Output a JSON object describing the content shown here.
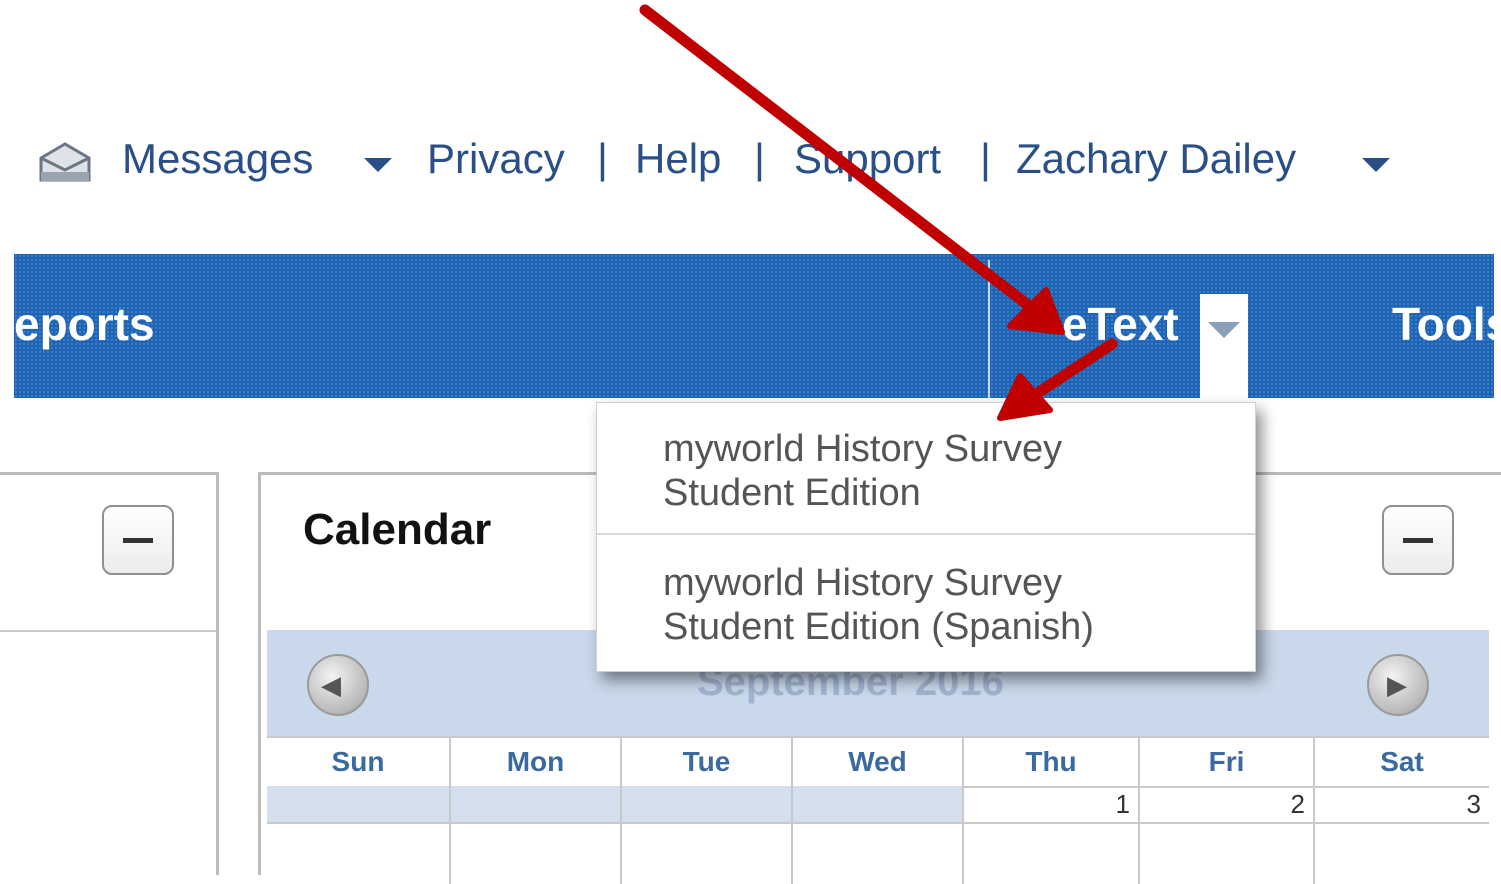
{
  "topbar": {
    "messages": "Messages",
    "privacy": "Privacy",
    "help": "Help",
    "support": "Support",
    "user": "Zachary Dailey",
    "sep": "|"
  },
  "nav": {
    "reports": "eports",
    "etext": "eText",
    "tools": "Tools"
  },
  "etext_menu": {
    "items": [
      {
        "line1": "myworld History Survey",
        "line2": "Student Edition"
      },
      {
        "line1": "myworld History Survey",
        "line2": "Student Edition (Spanish)"
      }
    ]
  },
  "calendar": {
    "title": "Calendar",
    "month": "September 2016",
    "days": [
      "Sun",
      "Mon",
      "Tue",
      "Wed",
      "Thu",
      "Fri",
      "Sat"
    ],
    "week1": [
      "",
      "",
      "",
      "",
      "1",
      "2",
      "3"
    ]
  },
  "colors": {
    "nav_blue": "#1e64b4",
    "link_blue": "#2a4f86",
    "annotation_red": "#c00000"
  },
  "icons": {
    "messages": "envelope-icon",
    "dropdown": "caret-down-icon",
    "collapse": "minus-icon",
    "prev": "arrow-left-icon",
    "next": "arrow-right-icon"
  }
}
